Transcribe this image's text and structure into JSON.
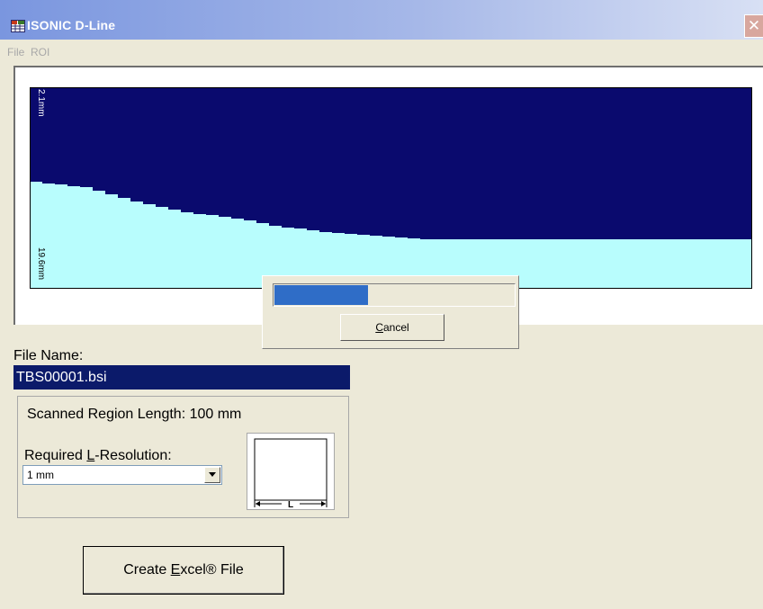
{
  "window": {
    "title": "ISONIC D-Line",
    "close_glyph": "✕",
    "titlebar_color": "#7a96df"
  },
  "menu": [
    "File",
    "ROI"
  ],
  "plot": {
    "top_label": "2.1mm",
    "bottom_label": "19.6mm",
    "colors": {
      "background": "#0a0a6e",
      "fill": "#b8fdfd"
    }
  },
  "file": {
    "label": "File Name:",
    "value": "TBS00001.bsi"
  },
  "region": {
    "scan_length_label": "Scanned Region Length: 100 mm",
    "resolution_label_pre": "Required ",
    "resolution_label_key": "L",
    "resolution_label_post": "-Resolution:",
    "resolution_value": "1 mm",
    "diagram_label": "L"
  },
  "actions": {
    "excel_pre": "Create ",
    "excel_key": "E",
    "excel_post": "xcel® File"
  },
  "progress": {
    "fraction": 0.39,
    "cancel_key": "C",
    "cancel_post": "ancel"
  }
}
